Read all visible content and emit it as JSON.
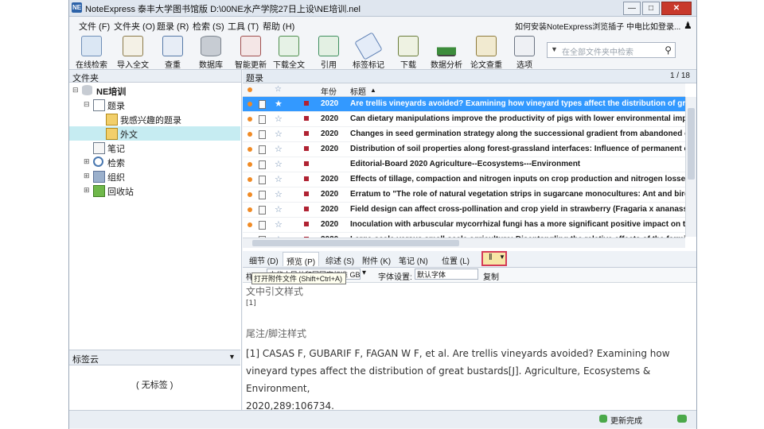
{
  "window": {
    "title": "NoteExpress   泰丰大学图书馆版   D:\\00NE水产学院27日上设\\NE培训.nel",
    "app_icon": "NE",
    "buttons": [
      "—",
      "□",
      "✕"
    ]
  },
  "menu": {
    "items": [
      "文件 (F)",
      "文件夹 (O)",
      "题录 (R)",
      "检索 (S)",
      "工具 (T)",
      "帮助 (H)"
    ],
    "right_link": "如何安装NoteExpress浏览插子",
    "right_login": "中电比如登录..."
  },
  "toolbar": {
    "tools": [
      "在线检索",
      "导入全文",
      "查重",
      "数据库",
      "智能更新",
      "下载全文",
      "引用",
      "标签标记",
      "下载",
      "数据分析",
      "论文查重",
      "选项"
    ],
    "search_placeholder": "在全部文件夹中检索"
  },
  "sidebar": {
    "header": "文件夹",
    "tree": [
      {
        "label": "NE培训",
        "icon": "database-icon",
        "bold": true
      },
      {
        "label": "题录",
        "icon": "list-icon"
      },
      {
        "label": "我感兴趣的题录",
        "icon": "folder-icon"
      },
      {
        "label": "外文",
        "icon": "folder-icon",
        "selected": true
      },
      {
        "label": "笔记",
        "icon": "note-icon"
      },
      {
        "label": "检索",
        "icon": "search-icon"
      },
      {
        "label": "组织",
        "icon": "organize-icon"
      },
      {
        "label": "回收站",
        "icon": "recycle-icon"
      }
    ],
    "tagcloud_header": "标签云",
    "no_tag": "( 无标签 )"
  },
  "list": {
    "header": "题录",
    "page": "1 / 18",
    "col_year": "年份",
    "col_title": "标题",
    "rows": [
      {
        "year": "2020",
        "title": "Are trellis vineyards avoided? Examining how vineyard types affect the distribution of great bus",
        "selected": true
      },
      {
        "year": "2020",
        "title": "Can dietary manipulations improve the productivity of pigs with lower environmental impact"
      },
      {
        "year": "2020",
        "title": "Changes in seed germination strategy along the successional gradient from abandoned cropland"
      },
      {
        "year": "2020",
        "title": "Distribution of soil properties along forest-grassland interfaces: Influence of permanent environ"
      },
      {
        "year": "",
        "title": "Editorial-Board  2020  Agriculture--Ecosystems---Environment"
      },
      {
        "year": "2020",
        "title": "Effects of tillage, compaction and nitrogen inputs on crop production and nitrogen losses"
      },
      {
        "year": "2020",
        "title": "Erratum to  \"The role of natural vegetation strips in sugarcane monocultures: Ant and bird"
      },
      {
        "year": "2020",
        "title": "Field design can affect cross-pollination and crop yield in strawberry (Fragaria x ananassa)"
      },
      {
        "year": "2020",
        "title": "Inoculation with arbuscular mycorrhizal fungi has a more significant positive impact on the gr"
      },
      {
        "year": "2020",
        "title": "Large-scale versus small-scale agriculture: Disentangling the relative effects of the farming"
      }
    ]
  },
  "tabs": [
    "细节 (D)",
    "预览 (P)",
    "综述 (S)",
    "附件 (K)",
    "笔记 (N)",
    "位置 (L)"
  ],
  "attach_tooltip": "打开附件文件 (Shift+Ctrl+A)",
  "stylebar": {
    "style_label": "样式:",
    "style_value": "中华人民共和国国家标准 GB/T 7714-2015",
    "font_label": "字体设置:",
    "font_value": "默认字体",
    "copy_label": "复制"
  },
  "preview": {
    "in_text_heading": "文中引文样式",
    "in_text_value": "[1]",
    "footnote_heading": "尾注/脚注样式",
    "reference_line1": "[1]    CASAS F, GUBARIF F, FAGAN W F, et al. Are trellis vineyards avoided? Examining how",
    "reference_line2": "vineyard types affect the distribution of great bustards[J]. Agriculture, Ecosystems & Environment,",
    "reference_line3": "2020,289:106734."
  },
  "status": {
    "update_done": "更新完成"
  },
  "colors": {
    "selection": "#3399ff",
    "folder_selection": "#c6ecf2",
    "highlight_border": "#d43b57",
    "flag": "#b02232",
    "priority_dot": "#f08a24"
  }
}
